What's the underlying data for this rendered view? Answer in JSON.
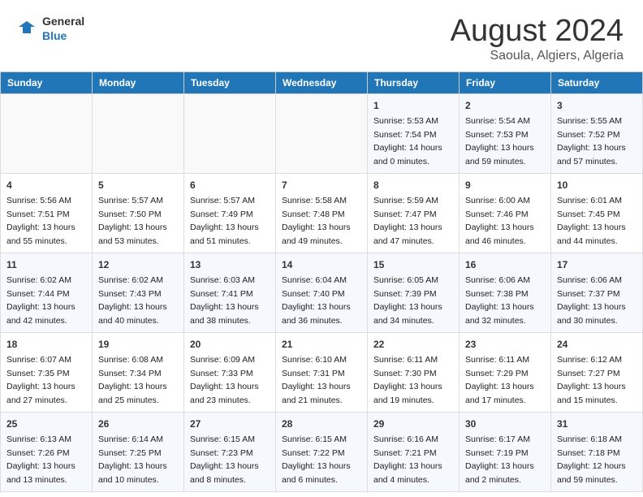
{
  "header": {
    "logo_general": "General",
    "logo_blue": "Blue",
    "month": "August 2024",
    "location": "Saoula, Algiers, Algeria"
  },
  "weekdays": [
    "Sunday",
    "Monday",
    "Tuesday",
    "Wednesday",
    "Thursday",
    "Friday",
    "Saturday"
  ],
  "weeks": [
    [
      {
        "day": "",
        "info": ""
      },
      {
        "day": "",
        "info": ""
      },
      {
        "day": "",
        "info": ""
      },
      {
        "day": "",
        "info": ""
      },
      {
        "day": "1",
        "info": "Sunrise: 5:53 AM\nSunset: 7:54 PM\nDaylight: 14 hours\nand 0 minutes."
      },
      {
        "day": "2",
        "info": "Sunrise: 5:54 AM\nSunset: 7:53 PM\nDaylight: 13 hours\nand 59 minutes."
      },
      {
        "day": "3",
        "info": "Sunrise: 5:55 AM\nSunset: 7:52 PM\nDaylight: 13 hours\nand 57 minutes."
      }
    ],
    [
      {
        "day": "4",
        "info": "Sunrise: 5:56 AM\nSunset: 7:51 PM\nDaylight: 13 hours\nand 55 minutes."
      },
      {
        "day": "5",
        "info": "Sunrise: 5:57 AM\nSunset: 7:50 PM\nDaylight: 13 hours\nand 53 minutes."
      },
      {
        "day": "6",
        "info": "Sunrise: 5:57 AM\nSunset: 7:49 PM\nDaylight: 13 hours\nand 51 minutes."
      },
      {
        "day": "7",
        "info": "Sunrise: 5:58 AM\nSunset: 7:48 PM\nDaylight: 13 hours\nand 49 minutes."
      },
      {
        "day": "8",
        "info": "Sunrise: 5:59 AM\nSunset: 7:47 PM\nDaylight: 13 hours\nand 47 minutes."
      },
      {
        "day": "9",
        "info": "Sunrise: 6:00 AM\nSunset: 7:46 PM\nDaylight: 13 hours\nand 46 minutes."
      },
      {
        "day": "10",
        "info": "Sunrise: 6:01 AM\nSunset: 7:45 PM\nDaylight: 13 hours\nand 44 minutes."
      }
    ],
    [
      {
        "day": "11",
        "info": "Sunrise: 6:02 AM\nSunset: 7:44 PM\nDaylight: 13 hours\nand 42 minutes."
      },
      {
        "day": "12",
        "info": "Sunrise: 6:02 AM\nSunset: 7:43 PM\nDaylight: 13 hours\nand 40 minutes."
      },
      {
        "day": "13",
        "info": "Sunrise: 6:03 AM\nSunset: 7:41 PM\nDaylight: 13 hours\nand 38 minutes."
      },
      {
        "day": "14",
        "info": "Sunrise: 6:04 AM\nSunset: 7:40 PM\nDaylight: 13 hours\nand 36 minutes."
      },
      {
        "day": "15",
        "info": "Sunrise: 6:05 AM\nSunset: 7:39 PM\nDaylight: 13 hours\nand 34 minutes."
      },
      {
        "day": "16",
        "info": "Sunrise: 6:06 AM\nSunset: 7:38 PM\nDaylight: 13 hours\nand 32 minutes."
      },
      {
        "day": "17",
        "info": "Sunrise: 6:06 AM\nSunset: 7:37 PM\nDaylight: 13 hours\nand 30 minutes."
      }
    ],
    [
      {
        "day": "18",
        "info": "Sunrise: 6:07 AM\nSunset: 7:35 PM\nDaylight: 13 hours\nand 27 minutes."
      },
      {
        "day": "19",
        "info": "Sunrise: 6:08 AM\nSunset: 7:34 PM\nDaylight: 13 hours\nand 25 minutes."
      },
      {
        "day": "20",
        "info": "Sunrise: 6:09 AM\nSunset: 7:33 PM\nDaylight: 13 hours\nand 23 minutes."
      },
      {
        "day": "21",
        "info": "Sunrise: 6:10 AM\nSunset: 7:31 PM\nDaylight: 13 hours\nand 21 minutes."
      },
      {
        "day": "22",
        "info": "Sunrise: 6:11 AM\nSunset: 7:30 PM\nDaylight: 13 hours\nand 19 minutes."
      },
      {
        "day": "23",
        "info": "Sunrise: 6:11 AM\nSunset: 7:29 PM\nDaylight: 13 hours\nand 17 minutes."
      },
      {
        "day": "24",
        "info": "Sunrise: 6:12 AM\nSunset: 7:27 PM\nDaylight: 13 hours\nand 15 minutes."
      }
    ],
    [
      {
        "day": "25",
        "info": "Sunrise: 6:13 AM\nSunset: 7:26 PM\nDaylight: 13 hours\nand 13 minutes."
      },
      {
        "day": "26",
        "info": "Sunrise: 6:14 AM\nSunset: 7:25 PM\nDaylight: 13 hours\nand 10 minutes."
      },
      {
        "day": "27",
        "info": "Sunrise: 6:15 AM\nSunset: 7:23 PM\nDaylight: 13 hours\nand 8 minutes."
      },
      {
        "day": "28",
        "info": "Sunrise: 6:15 AM\nSunset: 7:22 PM\nDaylight: 13 hours\nand 6 minutes."
      },
      {
        "day": "29",
        "info": "Sunrise: 6:16 AM\nSunset: 7:21 PM\nDaylight: 13 hours\nand 4 minutes."
      },
      {
        "day": "30",
        "info": "Sunrise: 6:17 AM\nSunset: 7:19 PM\nDaylight: 13 hours\nand 2 minutes."
      },
      {
        "day": "31",
        "info": "Sunrise: 6:18 AM\nSunset: 7:18 PM\nDaylight: 12 hours\nand 59 minutes."
      }
    ]
  ]
}
